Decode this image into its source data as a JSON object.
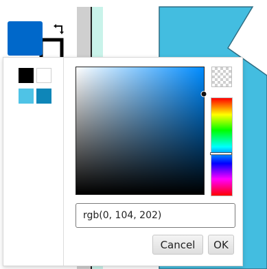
{
  "colors": {
    "primary": "#0068ca",
    "secondary": "#000000",
    "canvas_shape": "#43bde0",
    "canvas_shape_edge": "#2f6d83",
    "scroll_track": "#cfcfcf",
    "scroll_accent": "#c9f3ea",
    "hue_base": "#008cff"
  },
  "palette": {
    "swatches": [
      {
        "name": "black",
        "color": "#000000"
      },
      {
        "name": "white",
        "color": "#ffffff"
      },
      {
        "name": "sky-blue",
        "color": "#4fc3e6"
      },
      {
        "name": "teal-blue",
        "color": "#0e86b8"
      }
    ]
  },
  "picker": {
    "color_value": "rgb(0, 104, 202)",
    "hue_fraction": 0.57,
    "saturation": 1.0,
    "brightness": 0.79,
    "icons": {
      "swap": "swap-arrows-icon",
      "alpha": "transparency-checker-icon"
    }
  },
  "buttons": {
    "cancel_label": "Cancel",
    "ok_label": "OK"
  }
}
